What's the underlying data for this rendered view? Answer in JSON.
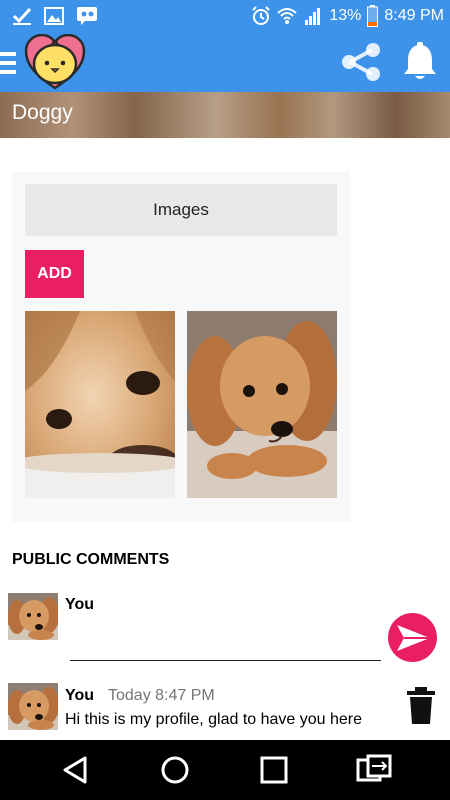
{
  "status_bar": {
    "battery": "13%",
    "time": "8:49 PM"
  },
  "app_bar": {
    "menu_icon": "hamburger-icon",
    "logo": "heart-chick-logo",
    "share_icon": "share-icon",
    "notification_icon": "bell-icon"
  },
  "banner": {
    "title": "Doggy"
  },
  "images_card": {
    "header": "Images",
    "add_label": "ADD"
  },
  "comments": {
    "title": "PUBLIC COMMENTS",
    "composer": {
      "author": "You",
      "value": "",
      "placeholder": ""
    },
    "items": [
      {
        "author": "You",
        "time": "Today 8:47 PM",
        "text": "Hi this is my profile, glad to have you here"
      }
    ]
  },
  "colors": {
    "primary": "#3d93ea",
    "accent": "#e91e63"
  }
}
